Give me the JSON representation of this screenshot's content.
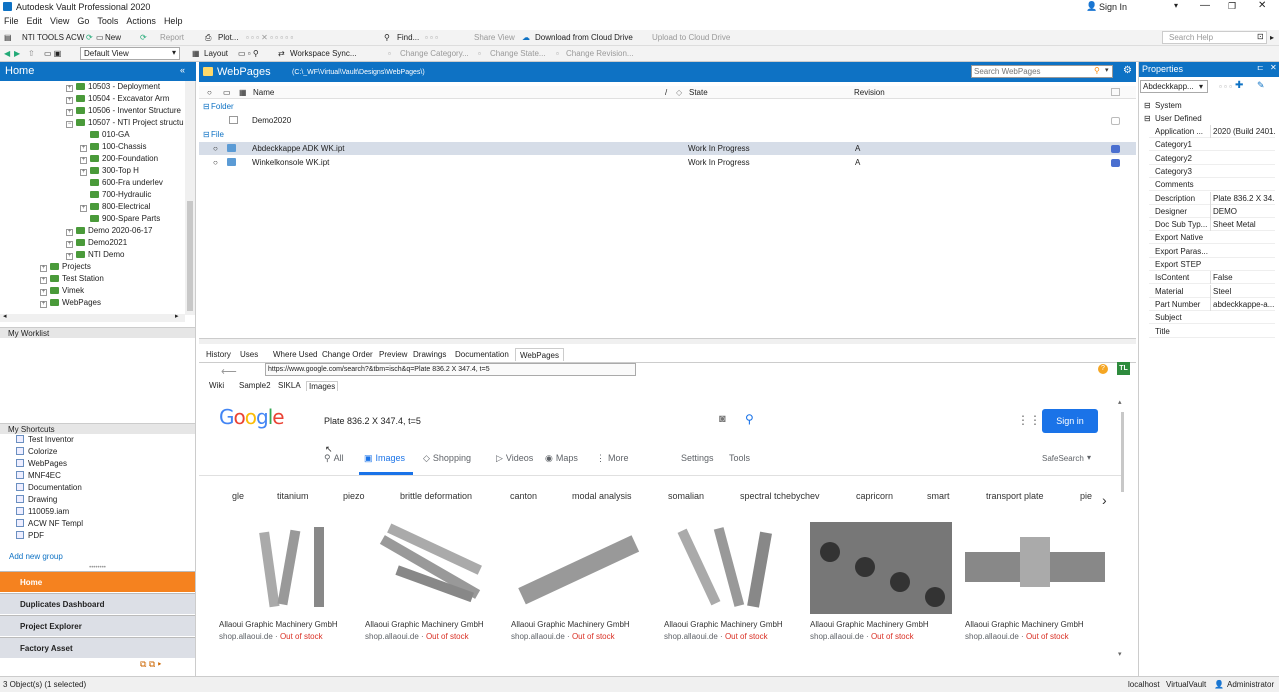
{
  "app": {
    "title": "Autodesk Vault Professional 2020",
    "sign_in": "Sign In",
    "window_controls": [
      "minimize-icon",
      "restore-icon",
      "close-icon"
    ]
  },
  "menu": [
    "File",
    "Edit",
    "View",
    "Go",
    "Tools",
    "Actions",
    "Help"
  ],
  "toolbar1": {
    "nti_tools": "NTI TOOLS ACW",
    "new": "New",
    "report": "Report",
    "plot": "Plot...",
    "find": "Find...",
    "share_view": "Share View",
    "download_cloud": "Download from Cloud Drive",
    "upload_cloud": "Upload to Cloud Drive",
    "search_help": "Search Help"
  },
  "toolbar2": {
    "view": "Default View",
    "layout": "Layout",
    "workspace_sync": "Workspace Sync...",
    "change_category": "Change Category...",
    "change_state": "Change State...",
    "change_revision": "Change Revision..."
  },
  "left": {
    "header": "Home",
    "tree": [
      {
        "label": "10503 - Deployment",
        "indent": 72,
        "plus": true
      },
      {
        "label": "10504 - Excavator Arm",
        "indent": 72,
        "plus": true
      },
      {
        "label": "10506 - Inventor Structure",
        "indent": 72,
        "plus": true
      },
      {
        "label": "10507 - NTI Project structu",
        "indent": 72,
        "plus": true
      },
      {
        "label": "010-GA",
        "indent": 86,
        "plus": false
      },
      {
        "label": "100-Chassis",
        "indent": 86,
        "plus": true
      },
      {
        "label": "200-Foundation",
        "indent": 86,
        "plus": true
      },
      {
        "label": "300-Top H",
        "indent": 86,
        "plus": true
      },
      {
        "label": "600-Fra underlev",
        "indent": 86,
        "plus": false
      },
      {
        "label": "700-Hydraulic",
        "indent": 86,
        "plus": false
      },
      {
        "label": "800-Electrical",
        "indent": 86,
        "plus": true
      },
      {
        "label": "900-Spare Parts",
        "indent": 86,
        "plus": false
      },
      {
        "label": "Demo 2020-06-17",
        "indent": 72,
        "plus": true
      },
      {
        "label": "Demo2021",
        "indent": 72,
        "plus": true
      },
      {
        "label": "NTI Demo",
        "indent": 72,
        "plus": true
      },
      {
        "label": "Projects",
        "indent": 46,
        "plus": true
      },
      {
        "label": "Test Station",
        "indent": 46,
        "plus": true
      },
      {
        "label": "Vimek",
        "indent": 46,
        "plus": true
      },
      {
        "label": "WebPages",
        "indent": 46,
        "plus": true
      }
    ],
    "worklist": "My Worklist",
    "shortcuts_header": "My Shortcuts",
    "shortcuts": [
      "Test Inventor",
      "Colorize",
      "WebPages",
      "MNF4EC",
      "Documentation",
      "Drawing",
      "110059.iam",
      "ACW NF Templ",
      "PDF"
    ],
    "add_group": "Add new group",
    "nav": [
      "Home",
      "Duplicates Dashboard",
      "Project Explorer",
      "Factory Asset"
    ]
  },
  "main": {
    "title": "WebPages",
    "path": "(C:\\_WF\\Virtual\\Vault\\Designs\\WebPages\\)",
    "search_placeholder": "Search WebPages",
    "columns": {
      "name": "Name",
      "state": "State",
      "revision": "Revision"
    },
    "folder_group": "Folder",
    "folders": [
      "Demo2020"
    ],
    "file_group": "File",
    "files": [
      {
        "name": "Abdeckkappe ADK WK.ipt",
        "state": "Work In Progress",
        "rev": "A"
      },
      {
        "name": "Winkelkonsole WK.ipt",
        "state": "Work In Progress",
        "rev": "A"
      }
    ],
    "tabs": [
      "History",
      "Uses",
      "Where Used",
      "Change Order",
      "Preview",
      "Drawings",
      "Documentation",
      "WebPages"
    ],
    "url": "https://www.google.com/search?&tbm=isch&q=Plate 836.2 X 347.4, t=5",
    "subtabs": [
      "Wiki",
      "Sample2",
      "SIKLA",
      "Images"
    ]
  },
  "google": {
    "logo": "Google",
    "query": "Plate 836.2 X 347.4, t=5",
    "sign_in": "Sign in",
    "search_tabs": [
      "All",
      "Images",
      "Shopping",
      "Videos",
      "Maps",
      "More"
    ],
    "settings": "Settings",
    "tools": "Tools",
    "safesearch": "SafeSearch",
    "chips": [
      "gle",
      "titanium",
      "piezo",
      "brittle deformation",
      "canton",
      "modal analysis",
      "somalian",
      "spectral tchebychev",
      "capricorn",
      "smart",
      "transport plate",
      "pie"
    ],
    "results": [
      {
        "title": "Allaoui Graphic Machinery GmbH",
        "source": "shop.allaoui.de",
        "stock": "Out of stock"
      },
      {
        "title": "Allaoui Graphic Machinery GmbH",
        "source": "shop.allaoui.de",
        "stock": "Out of stock"
      },
      {
        "title": "Allaoui Graphic Machinery GmbH",
        "source": "shop.allaoui.de",
        "stock": "Out of stock"
      },
      {
        "title": "Allaoui Graphic Machinery GmbH",
        "source": "shop.allaoui.de",
        "stock": "Out of stock"
      },
      {
        "title": "Allaoui Graphic Machinery GmbH",
        "source": "shop.allaoui.de",
        "stock": "Out of stock"
      },
      {
        "title": "Allaoui Graphic Machinery GmbH",
        "source": "shop.allaoui.de",
        "stock": "Out of stock"
      }
    ]
  },
  "properties": {
    "title": "Properties",
    "selected": "Abdeckkapp...",
    "system": "System",
    "user_defined": "User Defined",
    "rows": [
      {
        "k": "Application ...",
        "v": "2020 (Build 2401..."
      },
      {
        "k": "Category1",
        "v": ""
      },
      {
        "k": "Category2",
        "v": ""
      },
      {
        "k": "Category3",
        "v": ""
      },
      {
        "k": "Comments",
        "v": ""
      },
      {
        "k": "Description",
        "v": "Plate 836.2 X 34..."
      },
      {
        "k": "Designer",
        "v": "DEMO"
      },
      {
        "k": "Doc Sub Typ...",
        "v": "Sheet Metal"
      },
      {
        "k": "Export Native",
        "v": ""
      },
      {
        "k": "Export Paras...",
        "v": ""
      },
      {
        "k": "Export STEP",
        "v": ""
      },
      {
        "k": "IsContent",
        "v": "False"
      },
      {
        "k": "Material",
        "v": "Steel"
      },
      {
        "k": "Part Number",
        "v": "abdeckkappe-a..."
      },
      {
        "k": "Subject",
        "v": ""
      },
      {
        "k": "Title",
        "v": ""
      }
    ]
  },
  "status": {
    "left": "3 Object(s) (1 selected)",
    "server": "localhost",
    "vault": "VirtualVault",
    "user": "Administrator"
  },
  "colors": {
    "accent": "#0e72c4",
    "home_orange": "#f5821f",
    "folder_green": "#4a9a3a",
    "google_blue": "#1a73e8",
    "out_of_stock": "#d93025"
  }
}
